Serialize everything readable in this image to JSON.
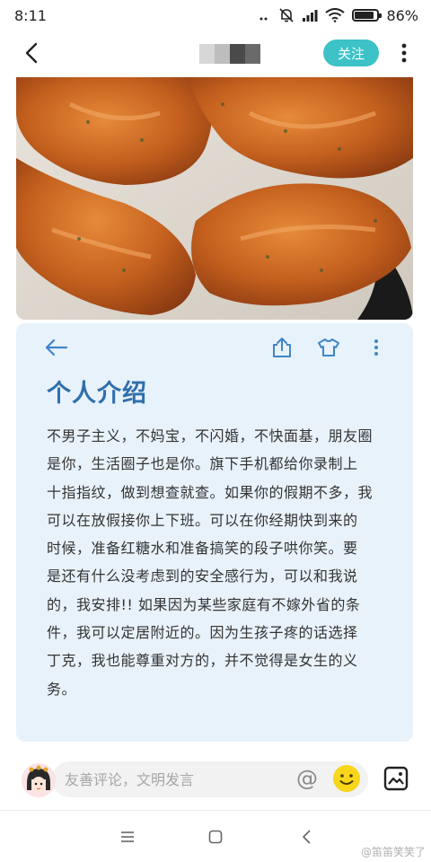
{
  "status_bar": {
    "time": "8:11",
    "battery": "86%",
    "battery_level": 0.86
  },
  "nav": {
    "follow_label": "关注"
  },
  "card": {
    "title": "个人介绍",
    "lines": [
      "不男子主义，不妈宝，不闪婚，不快面基，朋友圈",
      "是你，生活圈子也是你。旗下手机都给你录制上",
      "十指指纹，做到想查就查。如果你的假期不多，我",
      "可以在放假接你上下班。可以在你经期快到来的",
      "时候，准备红糖水和准备搞笑的段子哄你笑。要",
      "是还有什么没考虑到的安全感行为，可以和我说",
      "的，我安排!! 如果因为某些家庭有不嫁外省的条",
      "件，我可以定居附近的。因为生孩子疼的话选择",
      "丁克，我也能尊重对方的，并不觉得是女生的义",
      "务。"
    ]
  },
  "comment": {
    "placeholder": "友善评论，文明发言",
    "at_symbol": "@"
  },
  "watermark": "@笛笛笑笑了",
  "colors": {
    "accent_teal": "#3cc2c7",
    "card_bg": "#e8f2fb",
    "title_blue": "#2f6fab",
    "icon_blue": "#3f86c8"
  },
  "icons": [
    "back-arrow-icon",
    "more-vertical-icon",
    "share-icon",
    "tshirt-icon",
    "emoji-icon",
    "image-icon",
    "menu-icon",
    "home-square-icon",
    "back-triangle-icon"
  ]
}
